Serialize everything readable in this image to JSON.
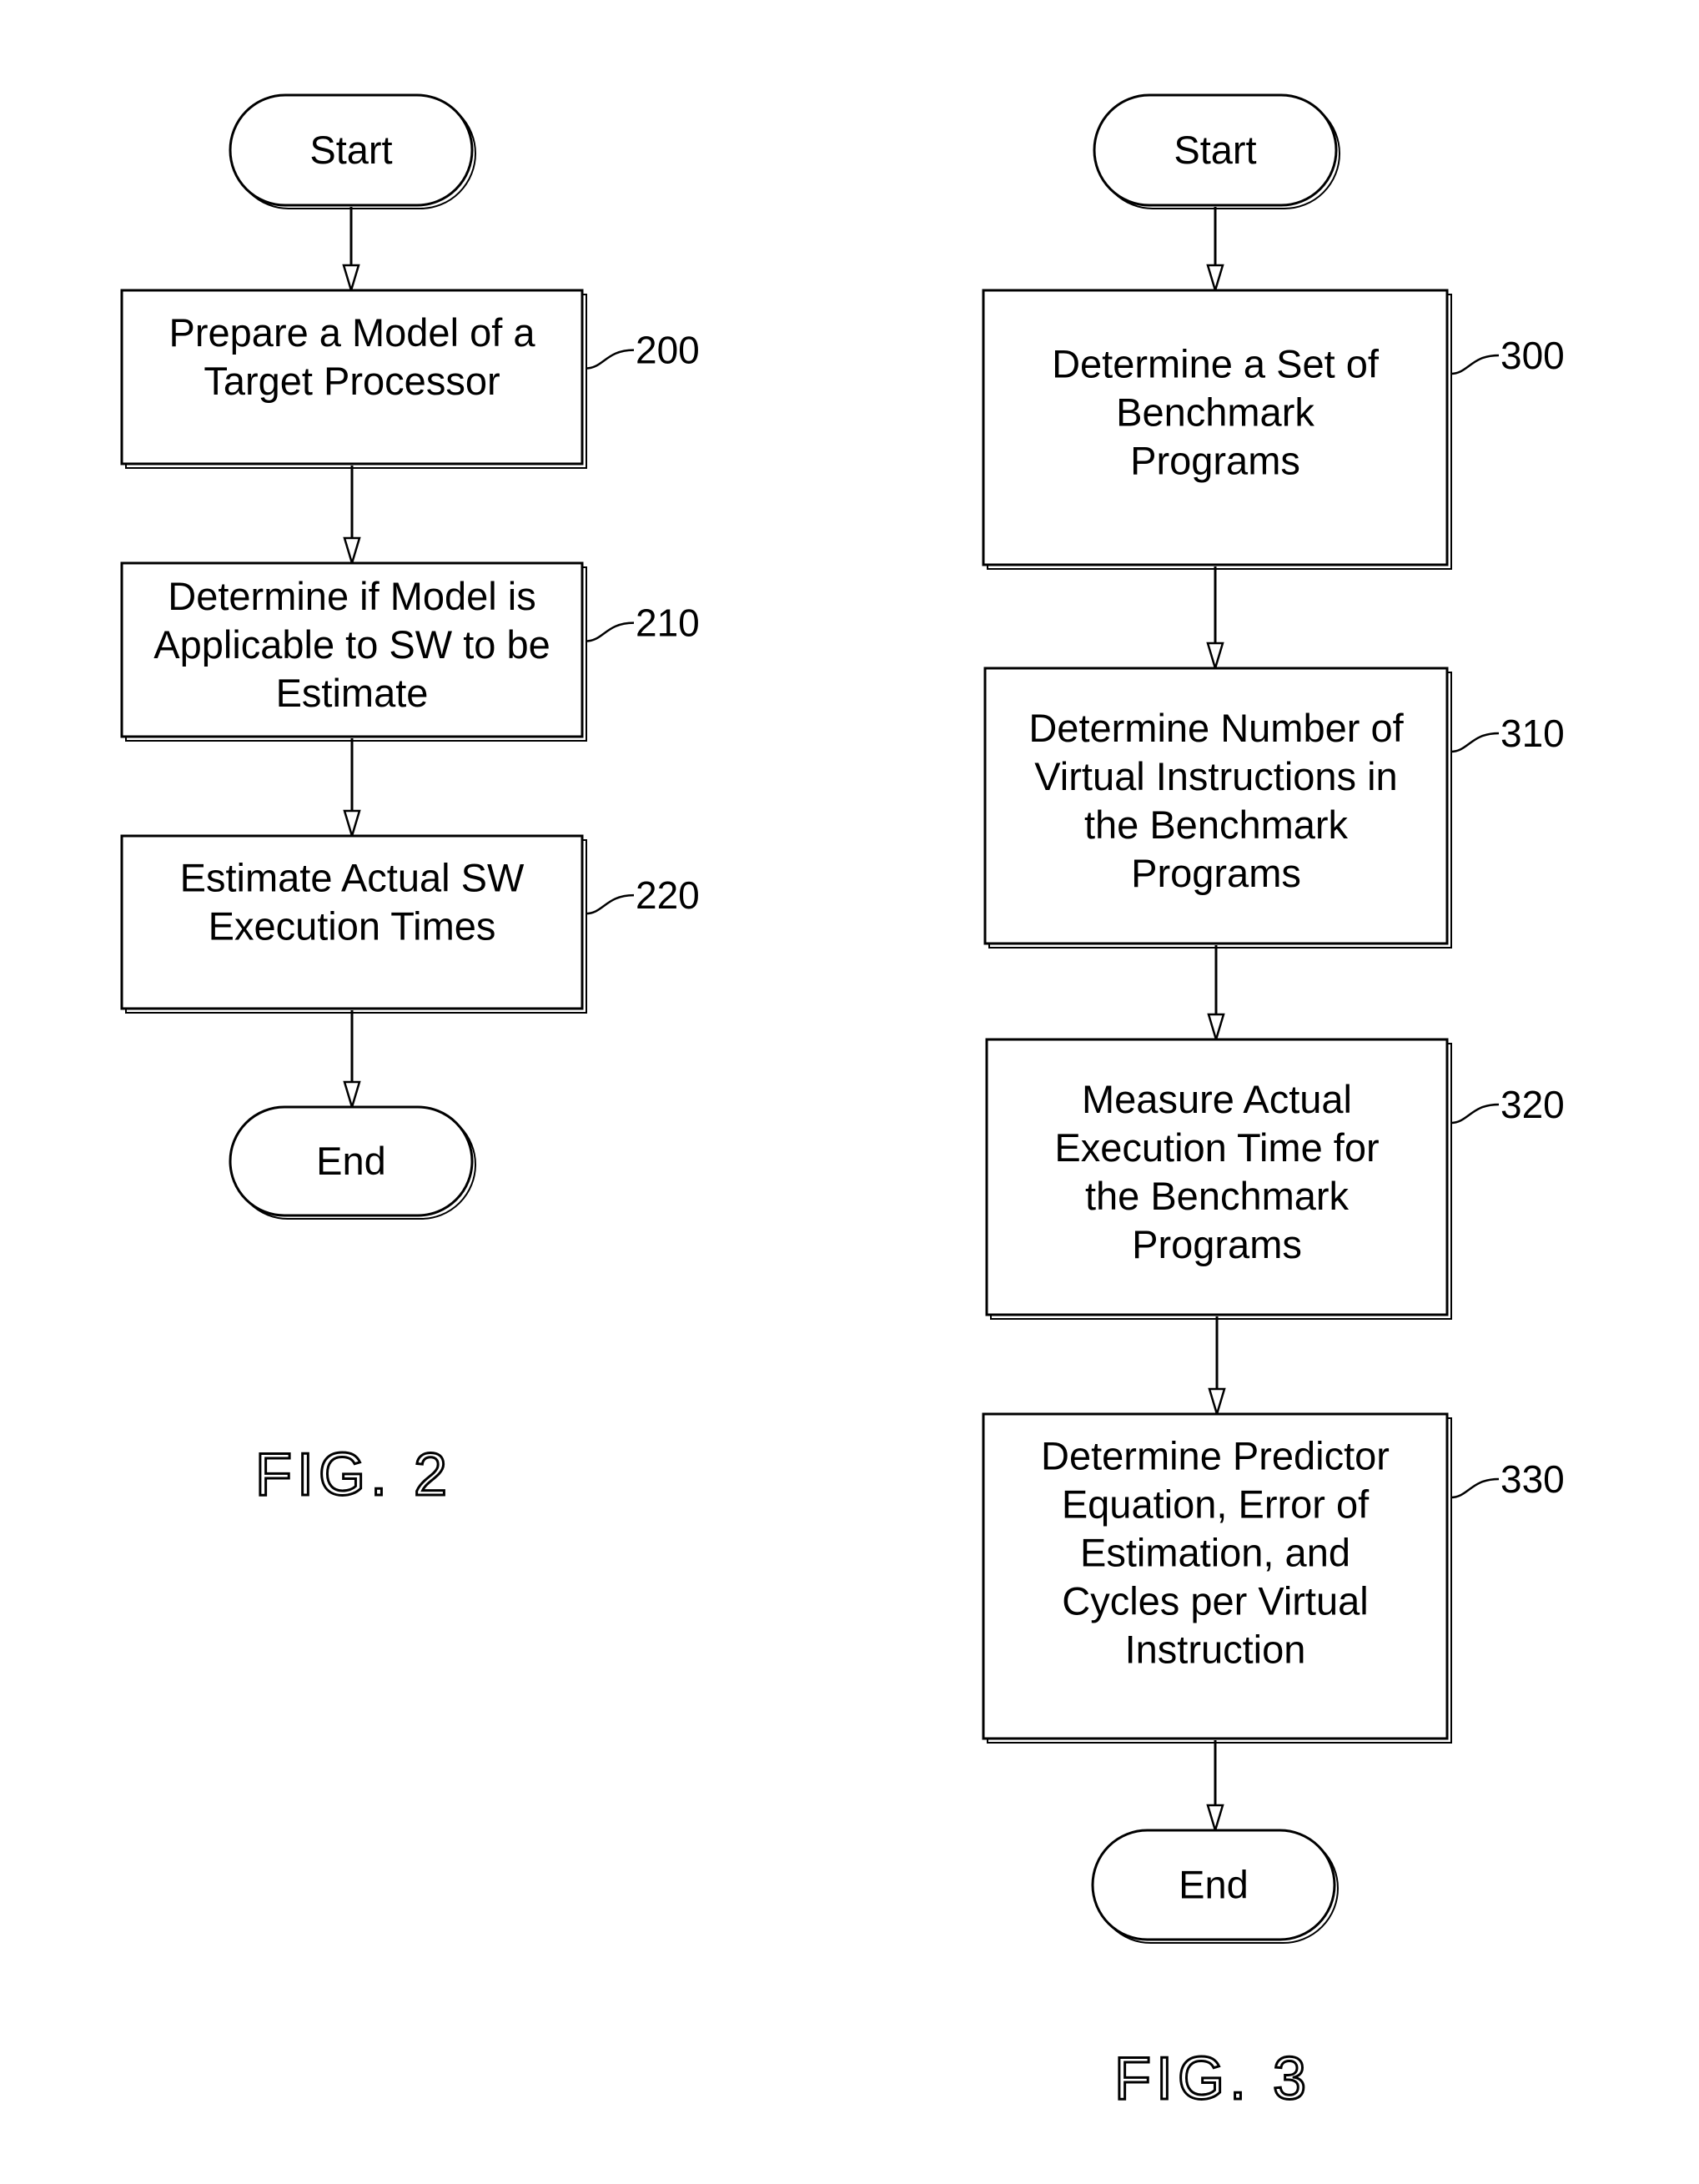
{
  "figures": [
    {
      "id": "fig2",
      "caption": "FIG. 2",
      "nodes": [
        {
          "id": "start",
          "type": "terminal",
          "lines": [
            "Start"
          ],
          "ref": ""
        },
        {
          "id": "n200",
          "type": "process",
          "lines": [
            "Prepare a Model of a",
            "Target Processor"
          ],
          "ref": "200"
        },
        {
          "id": "n210",
          "type": "process",
          "lines": [
            "Determine if Model is",
            "Applicable to SW to be",
            "Estimate"
          ],
          "ref": "210"
        },
        {
          "id": "n220",
          "type": "process",
          "lines": [
            "Estimate Actual SW",
            "Execution Times"
          ],
          "ref": "220"
        },
        {
          "id": "end",
          "type": "terminal",
          "lines": [
            "End"
          ],
          "ref": ""
        }
      ],
      "edges": [
        [
          "start",
          "n200"
        ],
        [
          "n200",
          "n210"
        ],
        [
          "n210",
          "n220"
        ],
        [
          "n220",
          "end"
        ]
      ]
    },
    {
      "id": "fig3",
      "caption": "FIG. 3",
      "nodes": [
        {
          "id": "start",
          "type": "terminal",
          "lines": [
            "Start"
          ],
          "ref": ""
        },
        {
          "id": "n300",
          "type": "process",
          "lines": [
            "Determine a Set of",
            "Benchmark",
            "Programs"
          ],
          "ref": "300"
        },
        {
          "id": "n310",
          "type": "process",
          "lines": [
            "Determine Number of",
            "Virtual Instructions in",
            "the Benchmark",
            "Programs"
          ],
          "ref": "310"
        },
        {
          "id": "n320",
          "type": "process",
          "lines": [
            "Measure Actual",
            "Execution Time for",
            "the Benchmark",
            "Programs"
          ],
          "ref": "320"
        },
        {
          "id": "n330",
          "type": "process",
          "lines": [
            "Determine Predictor",
            "Equation, Error of",
            "Estimation, and",
            "Cycles per Virtual",
            "Instruction"
          ],
          "ref": "330"
        },
        {
          "id": "end",
          "type": "terminal",
          "lines": [
            "End"
          ],
          "ref": ""
        }
      ],
      "edges": [
        [
          "start",
          "n300"
        ],
        [
          "n300",
          "n310"
        ],
        [
          "n310",
          "n320"
        ],
        [
          "n320",
          "n330"
        ],
        [
          "n330",
          "end"
        ]
      ]
    }
  ]
}
